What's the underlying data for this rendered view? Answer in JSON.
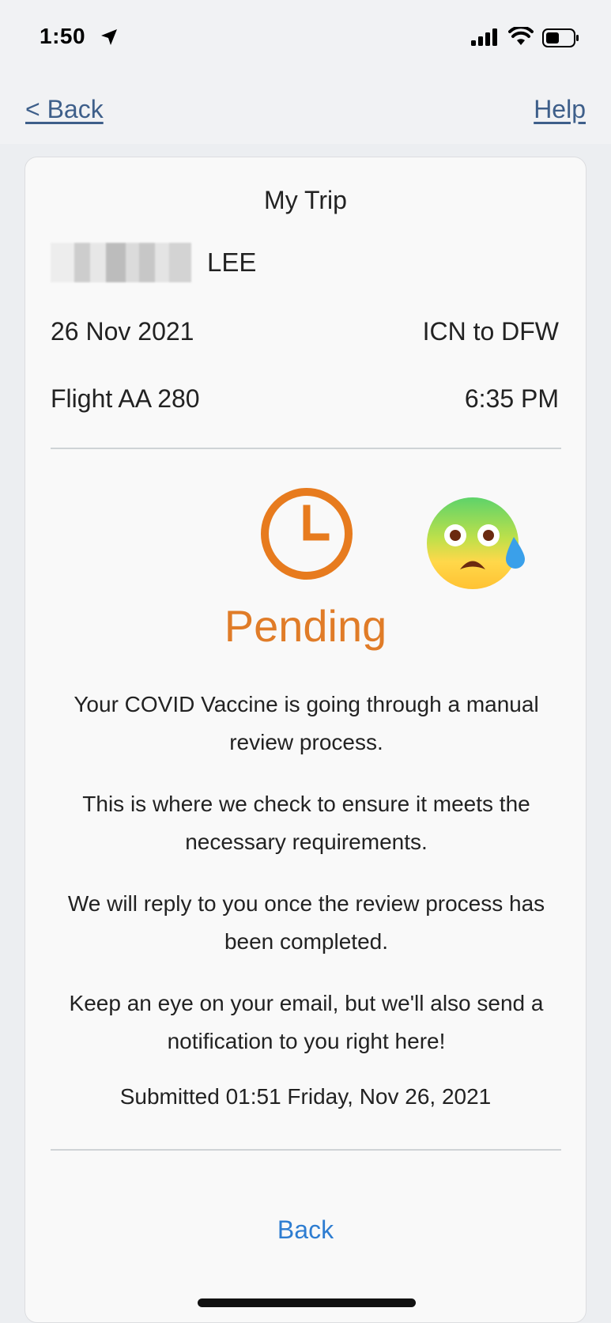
{
  "status_bar": {
    "time": "1:50",
    "icons": [
      "location-arrow-icon",
      "signal-icon",
      "wifi-icon",
      "battery-icon"
    ]
  },
  "nav": {
    "back_label": "< Back",
    "help_label": "Help"
  },
  "trip": {
    "title": "My Trip",
    "passenger_name": "LEE",
    "date": "26 Nov 2021",
    "route": "ICN to DFW",
    "flight": "Flight AA 280",
    "departure_time": "6:35 PM"
  },
  "status": {
    "label": "Pending",
    "icons": [
      "clock-icon",
      "anxious-face-emoji-icon"
    ],
    "messages": [
      "Your COVID Vaccine is going through a manual review process.",
      "This is where we check to ensure it meets the necessary requirements.",
      "We will reply to you once the review process has been completed.",
      "Keep an eye on your email, but we'll also send a notification to you right here!"
    ],
    "submitted": "Submitted 01:51 Friday, Nov 26, 2021"
  },
  "footer": {
    "back_button_label": "Back"
  },
  "colors": {
    "pending": "#e07c28",
    "link": "#3e5f8a",
    "button": "#2e7dd1"
  }
}
